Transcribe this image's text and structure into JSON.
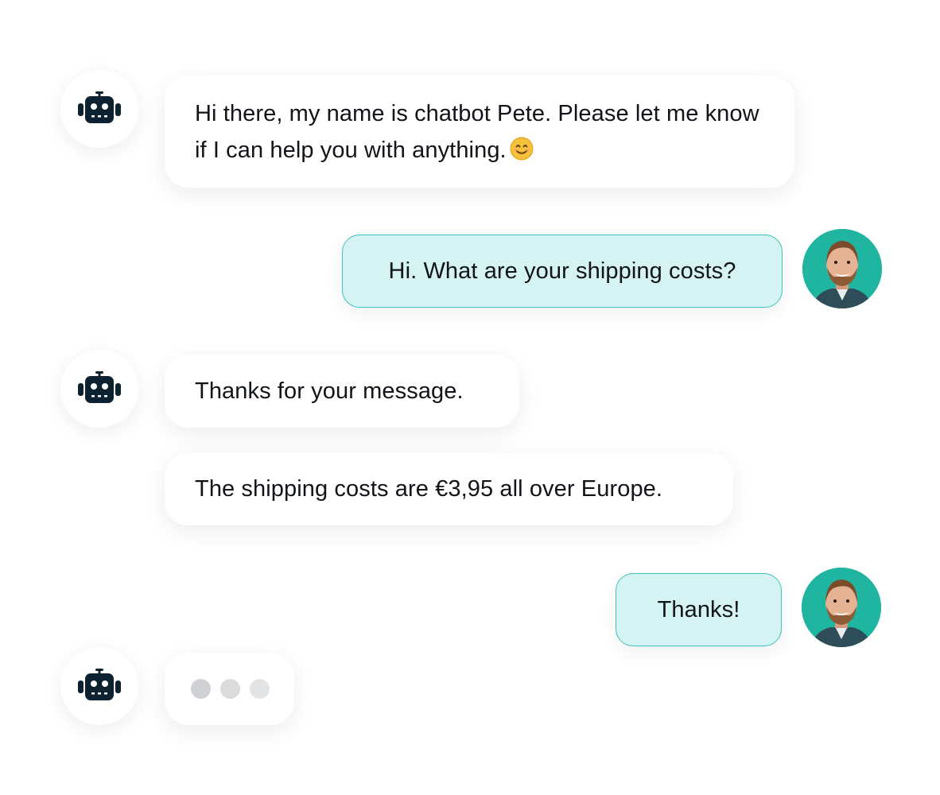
{
  "messages": [
    {
      "sender": "bot",
      "text": "Hi there, my name is chatbot Pete. Please let me know if I can help you with anything.",
      "emoji": "😊"
    },
    {
      "sender": "user",
      "text": "Hi. What are your shipping costs?"
    },
    {
      "sender": "bot",
      "text": "Thanks for your message."
    },
    {
      "sender": "bot",
      "text": "The shipping costs are €3,95 all over Europe."
    },
    {
      "sender": "user",
      "text": "Thanks!"
    },
    {
      "sender": "bot",
      "typing": true
    }
  ],
  "icons": {
    "bot": "robot-icon",
    "user": "user-photo-avatar",
    "emoji": "smiling-face-emoji-icon"
  },
  "colors": {
    "bot_bubble": "#ffffff",
    "user_bubble": "#d4f3f2",
    "user_bubble_border": "#3cc2bc",
    "user_avatar_bg": "#1fb5a0",
    "robot_icon": "#0d2230",
    "typing_dot": "#cfd1d4"
  }
}
